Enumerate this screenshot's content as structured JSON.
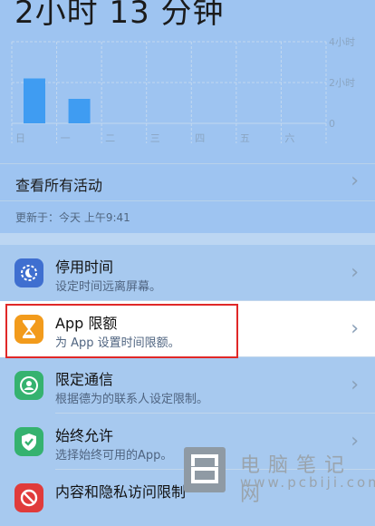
{
  "header": {
    "total_time": "2小时 13 分钟"
  },
  "chart_data": {
    "type": "bar",
    "categories": [
      "日",
      "一",
      "二",
      "三",
      "四",
      "五",
      "六"
    ],
    "values": [
      2.2,
      1.2,
      0,
      0,
      0,
      0,
      0
    ],
    "y_ticks": [
      "4小时",
      "2小时",
      "0"
    ],
    "ylim": [
      0,
      4
    ],
    "bar_color": "#3f9cf2",
    "grid": true
  },
  "see_all": {
    "label": "查看所有活动"
  },
  "updated": "更新于：今天 上午9:41",
  "settings": [
    {
      "title": "停用时间",
      "subtitle": "设定时间远离屏幕。",
      "icon": "downtime-icon",
      "color": "#3f6fd0"
    },
    {
      "title": "App 限额",
      "subtitle": "为 App 设置时间限额。",
      "icon": "hourglass-icon",
      "color": "#f29b1c"
    },
    {
      "title": "限定通信",
      "subtitle": "根据德为的联系人设定限制。",
      "icon": "contact-icon",
      "color": "#35b26f"
    },
    {
      "title": "始终允许",
      "subtitle": "选择始终可用的App。",
      "icon": "checkmark-icon",
      "color": "#35b26f"
    },
    {
      "title": "内容和隐私访问限制",
      "subtitle": "",
      "icon": "restriction-icon",
      "color": "#e03b3b"
    }
  ],
  "watermark": {
    "name": "电脑笔记网",
    "url": "www.pcbiji.com"
  }
}
